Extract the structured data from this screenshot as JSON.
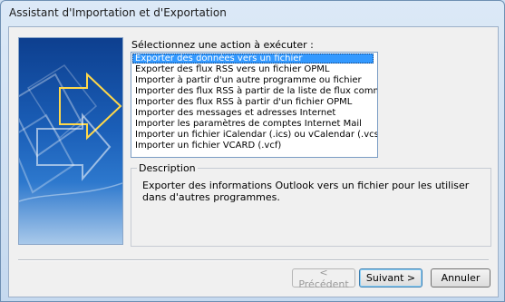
{
  "window": {
    "title": "Assistant d'Importation et d'Exportation"
  },
  "prompt": "Sélectionnez une action à exécuter :",
  "actions": [
    "Exporter des données vers un fichier",
    "Exporter des flux RSS vers un fichier OPML",
    "Importer à partir d'un autre programme ou fichier",
    "Importer des flux RSS à partir de la liste de flux commun",
    "Importer des flux RSS à partir d'un fichier OPML",
    "Importer des messages et adresses Internet",
    "Importer les paramètres de comptes Internet Mail",
    "Importer un fichier iCalendar (.ics) ou vCalendar (.vcs)",
    "Importer un fichier VCARD (.vcf)"
  ],
  "selected_index": 0,
  "description": {
    "legend": "Description",
    "text": "Exporter des informations Outlook vers un fichier pour les utiliser dans d'autres programmes."
  },
  "buttons": {
    "previous": "< Précédent",
    "next": "Suivant >",
    "cancel": "Annuler"
  },
  "colors": {
    "selection": "#3399ff",
    "graphic_dark": "#0d3f8f",
    "graphic_light": "#a9c9ea"
  }
}
